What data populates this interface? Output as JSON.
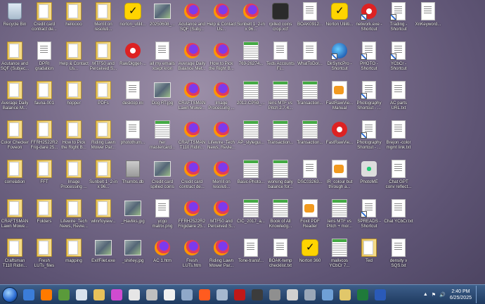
{
  "desktop": {
    "icons": [
      {
        "label": "Recycle Bin",
        "type": "recycle"
      },
      {
        "label": "Credit card contract de...",
        "type": "folder"
      },
      {
        "label": "helloooo",
        "type": "folder"
      },
      {
        "label": "Merrill on resoluti...",
        "type": "folder"
      },
      {
        "label": "norton_utilit...",
        "type": "norton"
      },
      {
        "label": "20250608_...",
        "type": "photo"
      },
      {
        "label": "Acutance and SQF (Subj...",
        "type": "firefox"
      },
      {
        "label": "Help & Contact Us...",
        "type": "firefox"
      },
      {
        "label": "Sunbelt 1_2-in x 96...",
        "type": "firefox"
      },
      {
        "label": "rpilled coins crop.xcf",
        "type": "app-dark"
      },
      {
        "label": "BOAK0912...",
        "type": "doc"
      },
      {
        "label": "Norton Utiliti...",
        "type": "norton"
      },
      {
        "label": "network.exe - Shortcut",
        "type": "app-red"
      },
      {
        "label": "Trading - Shortcut",
        "type": "doc"
      },
      {
        "label": "XnKeyword...",
        "type": "doc"
      },
      {
        "label": "Acutance and SQF (Subjec...",
        "type": "folder"
      },
      {
        "label": "DPRI gradation",
        "type": "doc"
      },
      {
        "label": "Help & Contact Us...",
        "type": "folder"
      },
      {
        "label": "MTF50 and Perceived S...",
        "type": "folder"
      },
      {
        "label": "RawDigger-...",
        "type": "app-red"
      },
      {
        "label": "all my emails xcept kron",
        "type": "doc"
      },
      {
        "label": "Average Daily Balance Met...",
        "type": "firefox"
      },
      {
        "label": "How to Pick the Right B...",
        "type": "firefox"
      },
      {
        "label": "769-26274...",
        "type": "sheet"
      },
      {
        "label": "Teds Accounts Fi...",
        "type": "doc"
      },
      {
        "label": "WhatToDoI...",
        "type": "doc"
      },
      {
        "label": "DirSyncPro - Shortcut",
        "type": "app-blue"
      },
      {
        "label": "PHOTO - Shortcut",
        "type": "doc"
      },
      {
        "label": "YCbCr - Shortcut",
        "type": "doc"
      },
      {
        "label": "",
        "type": "none"
      },
      {
        "label": "Average Daily Balance M...",
        "type": "folder"
      },
      {
        "label": "fauna-001",
        "type": "folder"
      },
      {
        "label": "hopper",
        "type": "folder"
      },
      {
        "label": "PDFs",
        "type": "folder"
      },
      {
        "label": "desktop.ini",
        "type": "doc"
      },
      {
        "label": "Dog RT.jpg",
        "type": "photo"
      },
      {
        "label": "CRAFTSMAN Lawn Mowe...",
        "type": "firefox"
      },
      {
        "label": "Image Processing ...",
        "type": "firefox"
      },
      {
        "label": "2012-CP59_...",
        "type": "sheet"
      },
      {
        "label": "lens MTF vs Pitch 2.7.4...",
        "type": "sheet"
      },
      {
        "label": "Transaction...",
        "type": "sheet"
      },
      {
        "label": "FastRawVie... Manual",
        "type": "pdf"
      },
      {
        "label": "Photography Shortcut - ...",
        "type": "doc"
      },
      {
        "label": "AC parts URL.txt",
        "type": "doc"
      },
      {
        "label": "",
        "type": "none"
      },
      {
        "label": "Color Checker Foveon",
        "type": "folder"
      },
      {
        "label": "FFRH2522R2 Frig-dare 25...",
        "type": "folder"
      },
      {
        "label": "How to Pick the Right B...",
        "type": "folder"
      },
      {
        "label": "Riding Lawn Mower Par...",
        "type": "folder"
      },
      {
        "label": "photothum...",
        "type": "doc"
      },
      {
        "label": "her mastercard...",
        "type": "sheet"
      },
      {
        "label": "CRAFTSMAN T110 Ridin...",
        "type": "firefox"
      },
      {
        "label": "Lifewire_Tech News, Revie...",
        "type": "firefox"
      },
      {
        "label": "AP_stylegui...",
        "type": "sheet"
      },
      {
        "label": "Transaction...",
        "type": "sheet"
      },
      {
        "label": "Transaction...",
        "type": "sheet"
      },
      {
        "label": "FastRawVie...",
        "type": "app-red"
      },
      {
        "label": "Photography Shortcut - ...",
        "type": "doc"
      },
      {
        "label": "Brejon -color mgmt link.txt",
        "type": "doc"
      },
      {
        "label": "",
        "type": "none"
      },
      {
        "label": "correlation",
        "type": "folder"
      },
      {
        "label": "FFT",
        "type": "folder"
      },
      {
        "label": "Image Processing ...",
        "type": "folder"
      },
      {
        "label": "Sunbelt 1_2-in x 96...",
        "type": "folder"
      },
      {
        "label": "Thumbs.db",
        "type": "db"
      },
      {
        "label": "Credit card spilled coins crop...",
        "type": "photo"
      },
      {
        "label": "Credit card contract de...",
        "type": "firefox"
      },
      {
        "label": "Merrill on resoluti...",
        "type": "firefox"
      },
      {
        "label": "Basic-Photo...",
        "type": "sheet"
      },
      {
        "label": "working daily balance for...",
        "type": "sheet"
      },
      {
        "label": "DSC03263...",
        "type": "doc"
      },
      {
        "label": "IR_colour but through a...",
        "type": "pdf"
      },
      {
        "label": "PhotoME",
        "type": "eye"
      },
      {
        "label": "Chat GPT conv reflect...",
        "type": "doc"
      },
      {
        "label": "",
        "type": "none"
      },
      {
        "label": "CRAFTSMAN Lawn Mowe...",
        "type": "folder"
      },
      {
        "label": "Folders",
        "type": "folder"
      },
      {
        "label": "Lifewire_Tech News, Revie...",
        "type": "folder"
      },
      {
        "label": "wllnrfoyiew...",
        "type": "folder"
      },
      {
        "label": "_Havliks.jpg",
        "type": "photo"
      },
      {
        "label": "ycgo matrix.png",
        "type": "doc"
      },
      {
        "label": "FFRH2522R2 Frigidaire 25...",
        "type": "firefox"
      },
      {
        "label": "MTF50 and Perceived S...",
        "type": "firefox"
      },
      {
        "label": "CIC_2017_a...",
        "type": "sheet"
      },
      {
        "label": "Book of All Knowledg...",
        "type": "sheet"
      },
      {
        "label": "Foxit PDF Reader",
        "type": "pdf"
      },
      {
        "label": "lens MTF vs Pitch + mor...",
        "type": "sheet"
      },
      {
        "label": "SPREADS - Shortcut",
        "type": "doc"
      },
      {
        "label": "Chat YCbCr.txt",
        "type": "doc"
      },
      {
        "label": "",
        "type": "none"
      },
      {
        "label": "Craftsman T110 Ridin...",
        "type": "folder"
      },
      {
        "label": "Fresh LUTs_files",
        "type": "folder"
      },
      {
        "label": "mapping",
        "type": "folder"
      },
      {
        "label": "ExifFilet.exe",
        "type": "photo"
      },
      {
        "label": "_shirley.jpg",
        "type": "photo"
      },
      {
        "label": "AC 1.htm",
        "type": "firefox"
      },
      {
        "label": "Fresh LUTs.htm",
        "type": "firefox"
      },
      {
        "label": "Riding Lawn Mower Par...",
        "type": "firefox"
      },
      {
        "label": "Tone-transf...",
        "type": "doc"
      },
      {
        "label": "BOAK-temp checklist.txt",
        "type": "doc"
      },
      {
        "label": "Norton 360",
        "type": "norton"
      },
      {
        "label": "malivcos YCbCr 7...",
        "type": "sheet"
      },
      {
        "label": "Ted",
        "type": "folder"
      },
      {
        "label": "density v SQS.txt",
        "type": "doc"
      },
      {
        "label": "",
        "type": "none"
      }
    ]
  },
  "taskbar": {
    "apps": [
      {
        "name": "ie-icon",
        "color": "#3b7dd8"
      },
      {
        "name": "firefox-icon",
        "color": "#ff7a00"
      },
      {
        "name": "snail-icon",
        "color": "#5a9a3a"
      },
      {
        "name": "photo-app-icon",
        "color": "#d9e2ee"
      },
      {
        "name": "file-explorer-icon",
        "color": "#e7c15a"
      },
      {
        "name": "color-wheel-icon",
        "color": "#d04bd0"
      },
      {
        "name": "media-icon",
        "color": "#e6e6e6"
      },
      {
        "name": "scanner-icon",
        "color": "#bfbfbf"
      },
      {
        "name": "dial-icon",
        "color": "#f0f0f0"
      },
      {
        "name": "gallery-icon",
        "color": "#8fa8c9"
      },
      {
        "name": "firefox-icon-2",
        "color": "#ff5b1f"
      },
      {
        "name": "window-icon",
        "color": "#a6b8cf"
      },
      {
        "name": "record-icon",
        "color": "#c01818"
      },
      {
        "name": "exiftool-icon",
        "color": "#3c3c3c"
      },
      {
        "name": "tool-icon",
        "color": "#8f8f8f"
      },
      {
        "name": "magnifier-icon",
        "color": "#d0d0d0"
      },
      {
        "name": "microscope-icon",
        "color": "#9aa7b8"
      },
      {
        "name": "network-icon",
        "color": "#6fa0d6"
      },
      {
        "name": "folder-icon",
        "color": "#e1c76a"
      },
      {
        "name": "excel-icon",
        "color": "#1f7a3a"
      },
      {
        "name": "word-icon",
        "color": "#2a5ab8"
      }
    ],
    "time": "2:40 PM",
    "date": "6/25/2025"
  }
}
